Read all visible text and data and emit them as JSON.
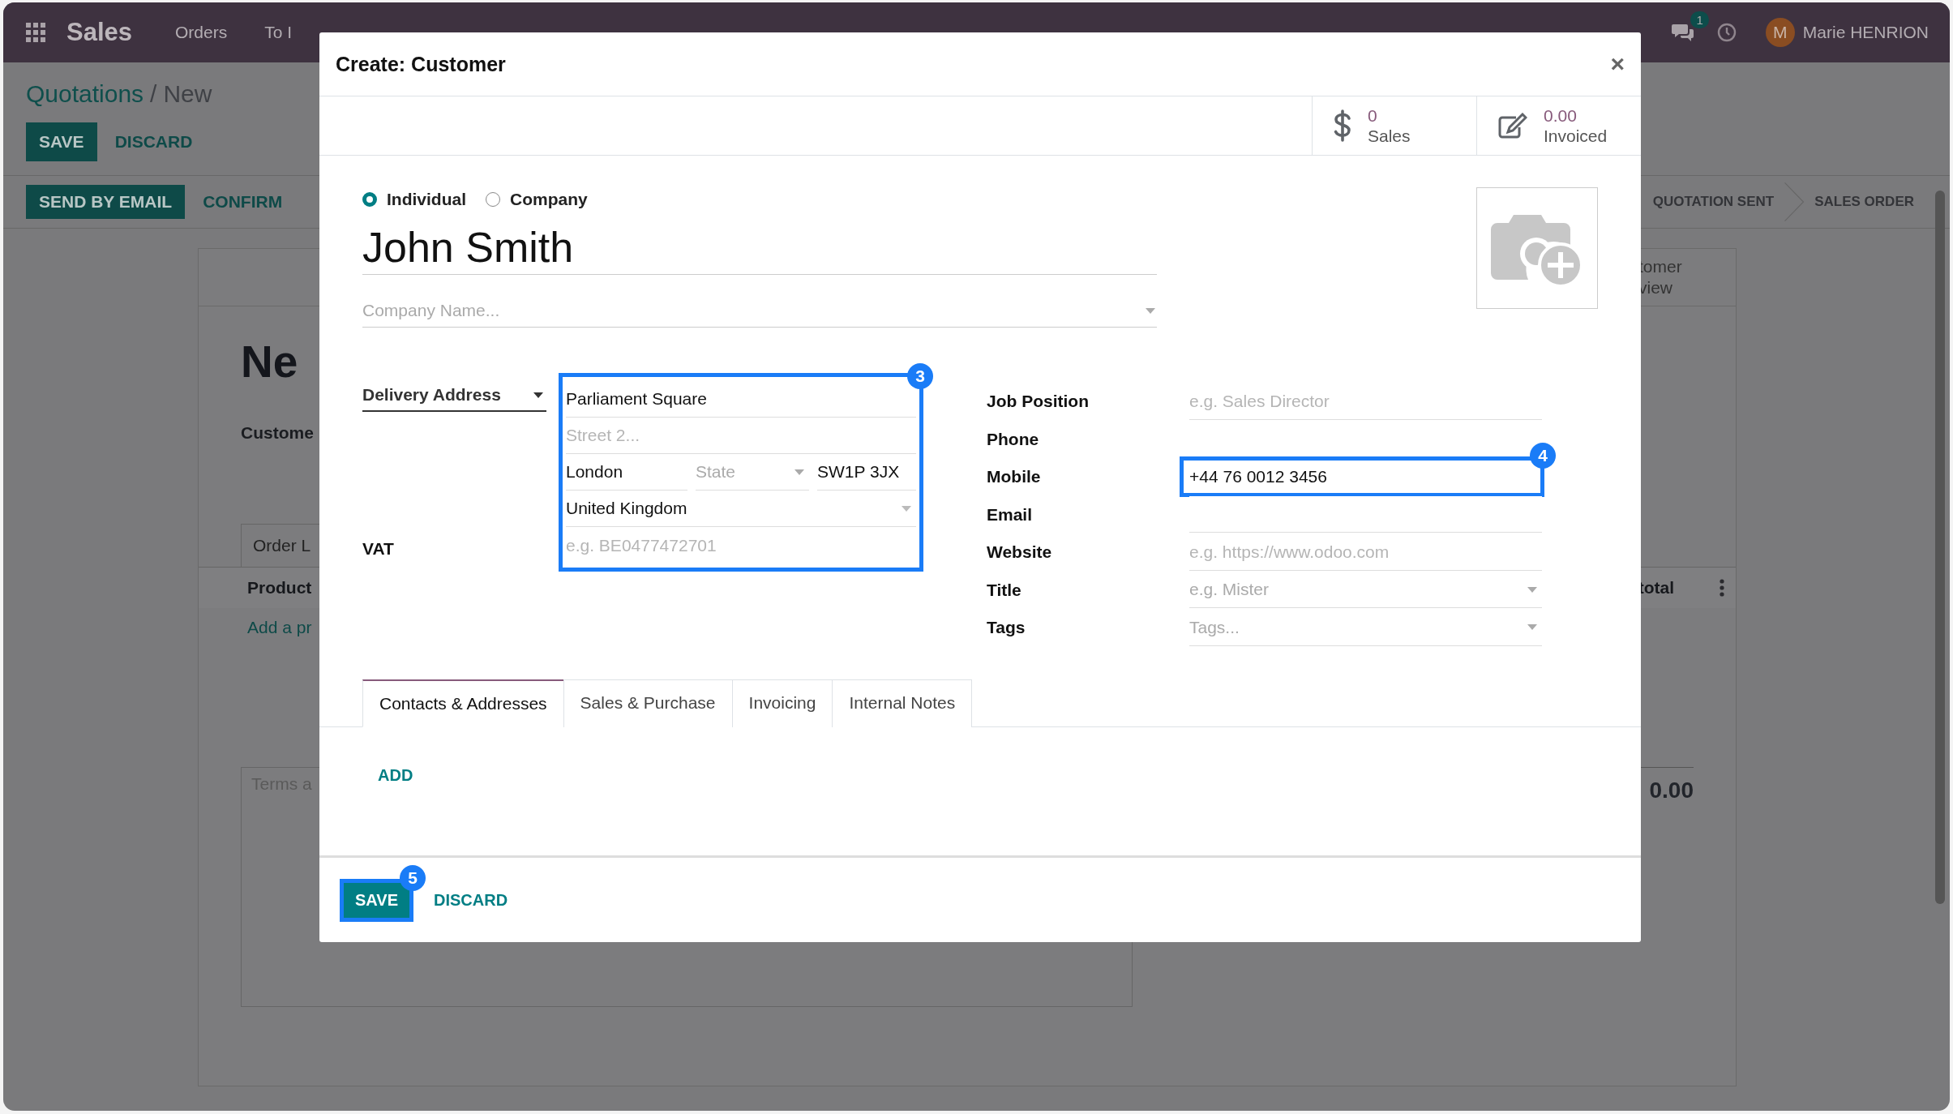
{
  "navbar": {
    "app": "Sales",
    "menu": [
      "Orders",
      "To I"
    ],
    "messages_badge": "1",
    "user": {
      "initial": "M",
      "name": "Marie HENRION"
    }
  },
  "background": {
    "breadcrumb": {
      "parent": "Quotations",
      "separator": "/",
      "current": "New"
    },
    "actions": [
      "SAVE",
      "DISCARD"
    ],
    "status_actions": [
      "SEND BY EMAIL",
      "CONFIRM"
    ],
    "stages": [
      "QUOTATION SENT",
      "SALES ORDER"
    ],
    "preview_button": [
      "tomer",
      "view"
    ],
    "title": "Ne",
    "customer_label": "Custome",
    "tab": "Order L",
    "columns": [
      "Product",
      "total"
    ],
    "add_line": "Add a pr",
    "terms_placeholder": "Terms a",
    "total": "0.00"
  },
  "dialog": {
    "title": "Create: Customer",
    "close": "×",
    "stats": [
      {
        "kind": "sales",
        "value": "0",
        "label": "Sales"
      },
      {
        "kind": "invoiced",
        "value": "0.00",
        "label": "Invoiced"
      }
    ],
    "company_type": [
      {
        "label": "Individual",
        "selected": true
      },
      {
        "label": "Company",
        "selected": false
      }
    ],
    "name": "John Smith",
    "company_placeholder": "Company Name...",
    "address_type": "Delivery Address",
    "address": {
      "callout": "3",
      "street": "Parliament Square",
      "street2_placeholder": "Street 2...",
      "city": "London",
      "state_placeholder": "State",
      "zip": "SW1P 3JX",
      "country": "United Kingdom",
      "vat_placeholder": "e.g. BE0477472701"
    },
    "vat_label": "VAT",
    "fields": [
      {
        "label": "Job Position",
        "kind": "input",
        "placeholder": "e.g. Sales Director"
      },
      {
        "label": "Phone",
        "kind": "input"
      },
      {
        "label": "Mobile",
        "kind": "input",
        "value": "+44 76 0012 3456",
        "callout": "4"
      },
      {
        "label": "Email",
        "kind": "input"
      },
      {
        "label": "Website",
        "kind": "input",
        "placeholder": "e.g. https://www.odoo.com"
      },
      {
        "label": "Title",
        "kind": "select",
        "placeholder": "e.g. Mister"
      },
      {
        "label": "Tags",
        "kind": "select",
        "placeholder": "Tags..."
      }
    ],
    "tabs": [
      {
        "label": "Contacts & Addresses",
        "selected": true
      },
      {
        "label": "Sales & Purchase",
        "selected": false
      },
      {
        "label": "Invoicing",
        "selected": false
      },
      {
        "label": "Internal Notes",
        "selected": false
      }
    ],
    "add": "ADD",
    "footer": {
      "save": "SAVE",
      "save_callout": "5",
      "discard": "DISCARD"
    }
  }
}
